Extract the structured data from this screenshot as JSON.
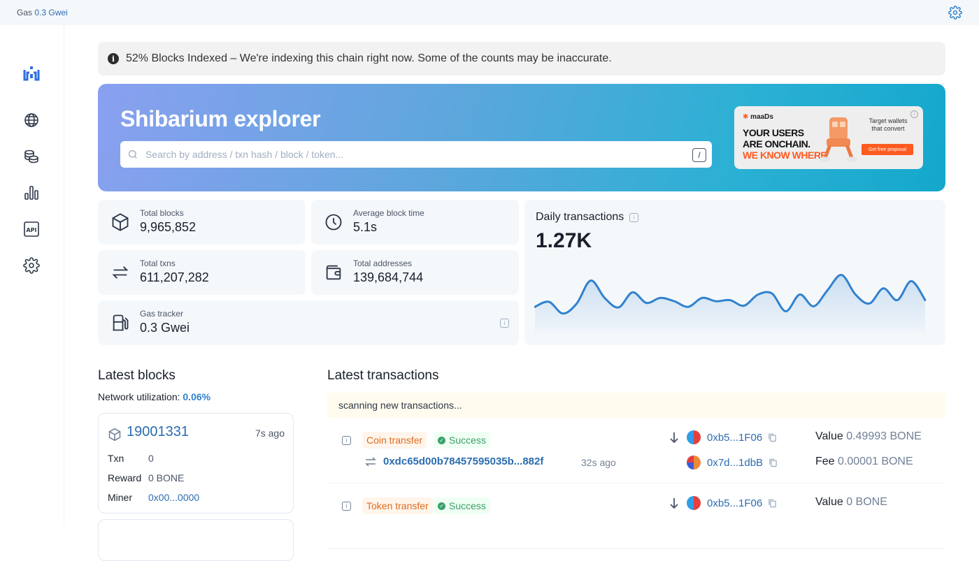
{
  "topbar": {
    "gas_label": "Gas",
    "gas_value": "0.3 Gwei"
  },
  "alert": {
    "text": "52% Blocks Indexed – We're indexing this chain right now. Some of the counts may be inaccurate."
  },
  "hero": {
    "title": "Shibarium explorer",
    "search_placeholder": "Search by address / txn hash / block / token...",
    "search_shortcut": "/"
  },
  "ad": {
    "brand": "maaDs",
    "line1": "YOUR USERS",
    "line2": "ARE ONCHAIN.",
    "line3": "WE KNOW WHERE",
    "tagline": "Target wallets that convert",
    "cta": "Get free proposal"
  },
  "stats": {
    "total_blocks": {
      "label": "Total blocks",
      "value": "9,965,852"
    },
    "avg_block_time": {
      "label": "Average block time",
      "value": "5.1s"
    },
    "total_txns": {
      "label": "Total txns",
      "value": "611,207,282"
    },
    "total_addresses": {
      "label": "Total addresses",
      "value": "139,684,744"
    },
    "gas_tracker": {
      "label": "Gas tracker",
      "value": "0.3 Gwei"
    }
  },
  "daily": {
    "title": "Daily transactions",
    "value": "1.27K"
  },
  "chart_data": {
    "type": "area",
    "title": "Daily transactions",
    "series": [
      {
        "values": [
          46,
          55,
          34,
          52,
          93,
          62,
          45,
          72,
          53,
          62,
          56,
          46,
          62,
          56,
          58,
          48,
          68,
          70,
          38,
          68,
          47,
          76,
          103,
          68,
          52,
          79,
          58,
          92,
          58
        ]
      }
    ],
    "ylim": [
      0,
      130
    ],
    "grid": false
  },
  "latest_blocks": {
    "title": "Latest blocks",
    "util_label": "Network utilization:",
    "util_value": "0.06%",
    "block": {
      "number": "19001331",
      "age": "7s ago",
      "txn_label": "Txn",
      "txn_value": "0",
      "reward_label": "Reward",
      "reward_value": "0 BONE",
      "miner_label": "Miner",
      "miner_value": "0x00...0000"
    }
  },
  "latest_transactions": {
    "title": "Latest transactions",
    "scanning": "scanning new transactions...",
    "items": [
      {
        "type": "Coin transfer",
        "status": "Success",
        "hash": "0xdc65d00b78457595035b...882f",
        "age": "32s ago",
        "from": "0xb5...1F06",
        "to": "0x7d...1dbB",
        "value_label": "Value",
        "value": "0.49993 BONE",
        "fee_label": "Fee",
        "fee": "0.00001 BONE"
      },
      {
        "type": "Token transfer",
        "status": "Success",
        "from": "0xb5...1F06",
        "value_label": "Value",
        "value": "0 BONE"
      }
    ]
  }
}
